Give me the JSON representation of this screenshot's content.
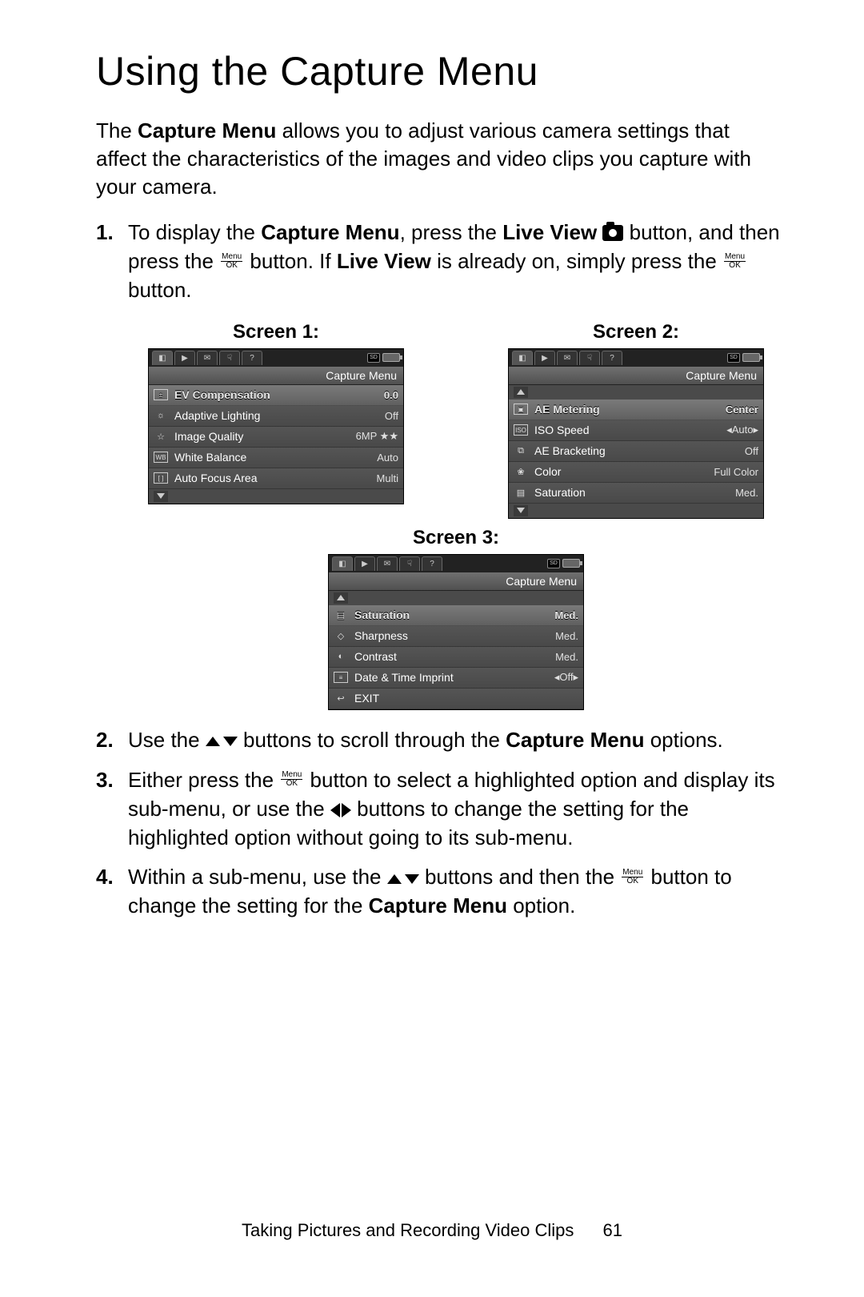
{
  "title": "Using the Capture Menu",
  "intro_parts": {
    "a": "The ",
    "b": "Capture Menu",
    "c": " allows you to adjust various camera settings that affect the characteristics of the images and video clips you capture with your camera."
  },
  "steps": {
    "s1": {
      "num": "1.",
      "a": "To display the ",
      "b": "Capture Menu",
      "c": ", press the ",
      "d": "Live View",
      "e": " ",
      "f": " button, and then press the ",
      "g": " button. If ",
      "h": "Live View",
      "i": " is already on, simply press the ",
      "j": " button."
    },
    "s2": {
      "num": "2.",
      "a": "Use the ",
      "b": " buttons to scroll through the ",
      "c": "Capture Menu",
      "d": " options."
    },
    "s3": {
      "num": "3.",
      "a": "Either press the ",
      "b": " button to select a highlighted option and display its sub-menu, or use the ",
      "c": " buttons to change the setting for the highlighted option without going to its sub-menu."
    },
    "s4": {
      "num": "4.",
      "a": "Within a sub-menu, use the ",
      "b": " buttons and then the ",
      "c": " button to change the setting for the ",
      "d": "Capture Menu",
      "e": " option."
    }
  },
  "menuok": {
    "top": "Menu",
    "bot": "OK"
  },
  "screens": {
    "labels": {
      "s1": "Screen 1:",
      "s2": "Screen 2:",
      "s3": "Screen 3:"
    },
    "menu_title": "Capture Menu",
    "tab_icons": [
      "camera",
      "play",
      "mail",
      "hand",
      "help"
    ],
    "screen1": {
      "rows": [
        {
          "icon": "ev",
          "label": "EV Compensation",
          "value": "0.0",
          "sel": true
        },
        {
          "icon": "sun",
          "label": "Adaptive Lighting",
          "value": "Off",
          "sel": false
        },
        {
          "icon": "star",
          "label": "Image Quality",
          "value": "6MP ★★",
          "sel": false
        },
        {
          "icon": "wb",
          "label": "White Balance",
          "value": "Auto",
          "sel": false
        },
        {
          "icon": "afarea",
          "label": "Auto Focus Area",
          "value": "Multi",
          "sel": false
        }
      ],
      "scroll": "down"
    },
    "screen2": {
      "rows": [
        {
          "icon": "meter",
          "label": "AE Metering",
          "value": "Center",
          "sel": true
        },
        {
          "icon": "iso",
          "label": "ISO Speed",
          "value": "◂Auto▸",
          "sel": false
        },
        {
          "icon": "aeb",
          "label": "AE Bracketing",
          "value": "Off",
          "sel": false
        },
        {
          "icon": "color",
          "label": "Color",
          "value": "Full Color",
          "sel": false
        },
        {
          "icon": "sat",
          "label": "Saturation",
          "value": "Med.",
          "sel": false
        }
      ],
      "scroll": "both"
    },
    "screen3": {
      "rows": [
        {
          "icon": "sat",
          "label": "Saturation",
          "value": "Med.",
          "sel": true
        },
        {
          "icon": "sharp",
          "label": "Sharpness",
          "value": "Med.",
          "sel": false
        },
        {
          "icon": "contrast",
          "label": "Contrast",
          "value": "Med.",
          "sel": false
        },
        {
          "icon": "date",
          "label": "Date & Time Imprint",
          "value": "◂Off▸",
          "sel": false
        },
        {
          "icon": "exit",
          "label": "EXIT",
          "value": "",
          "sel": false
        }
      ],
      "scroll": "up"
    }
  },
  "footer": {
    "section": "Taking Pictures and Recording Video Clips",
    "page": "61"
  }
}
